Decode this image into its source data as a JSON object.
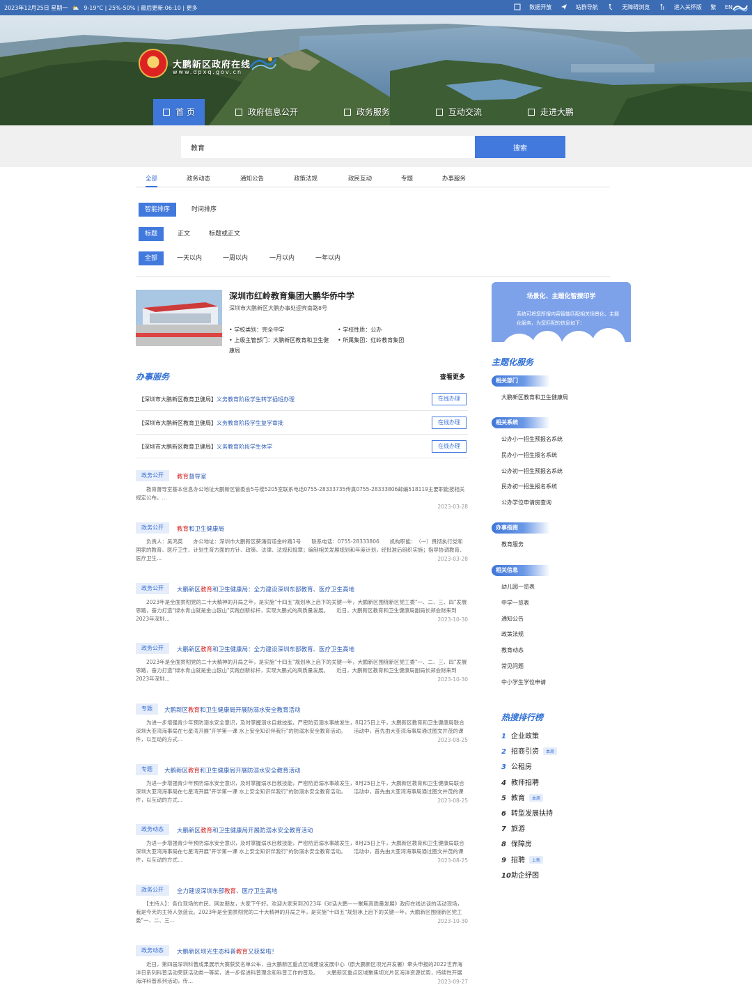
{
  "topbar": {
    "date": "2023年12月25日 星期一",
    "weather": "9-19°C | 25%-50% | 最后更新:06:10 | 更多",
    "links": [
      "数据开放",
      "站群导航",
      "无障碍浏览",
      "进入关怀版",
      "繁",
      "EN"
    ]
  },
  "banner": {
    "site_title": "大鹏新区政府在线",
    "site_url": "www.dpxq.gov.cn"
  },
  "nav": [
    "首  页",
    "政府信息公开",
    "政务服务",
    "互动交流",
    "走进大鹏"
  ],
  "search": {
    "value": "教育",
    "button": "搜索"
  },
  "category_tabs": [
    "全部",
    "政务动态",
    "通知公告",
    "政策法规",
    "政民互动",
    "专题",
    "办事服务"
  ],
  "sort_options": [
    "智能排序",
    "时间排序"
  ],
  "scope_options": [
    "标题",
    "正文",
    "标题或正文"
  ],
  "time_options": [
    "全部",
    "一天以内",
    "一周以内",
    "一月以内",
    "一年以内"
  ],
  "school": {
    "name": "深圳市红岭教育集团大鹏华侨中学",
    "address": "深圳市大鹏新区大鹏办事处迎宾南路8号",
    "type": "• 学校类别：完全中学",
    "nature": "• 学校性质：公办",
    "dept": "• 上级主管部门：大鹏新区教育和卫生健",
    "dept_cont": "康局",
    "group": "• 所属集团：红岭教育集团"
  },
  "affairs": {
    "title": "办事服务",
    "more": "查看更多",
    "items": [
      {
        "dept": "【深圳市大鹏新区教育卫健局】",
        "name": "义务教育阶段学生转学插班办理",
        "btn": "在线办理"
      },
      {
        "dept": "【深圳市大鹏新区教育卫健局】",
        "name": "义务教育阶段学生复学审批",
        "btn": "在线办理"
      },
      {
        "dept": "【深圳市大鹏新区教育卫健局】",
        "name": "义务教育阶段学生休学",
        "btn": "在线办理"
      }
    ]
  },
  "results": [
    {
      "tag": "政务公开",
      "pre": "",
      "hl": "教育",
      "post": "督导室",
      "snippet": "　　教育督导室基本信息办公地址大鹏新区管委会5号楼5205室联系电话0755-28333735传真0755-28333806邮编518119主要职能按相关规定公布。...",
      "date": "2023-03-28"
    },
    {
      "tag": "政务公开",
      "pre": "",
      "hl": "教育",
      "post": "和卫生健康局",
      "snippet": "　　负责人：吴鸿英　　办公地址：深圳市大鹏新区葵涌街道金岭路1号　　联系电话：0755-28333806　　机构职能：　（一）贯彻执行党和国家的教育、医疗卫生、计划生育方面的方针、政策、法律、法规和规章；编制相关发展规划和年度计划，经批准后组织实施；指导协调教育、医疗卫生...",
      "date": "2023-03-28"
    },
    {
      "tag": "政务公开",
      "pre": "大鹏新区",
      "hl": "教育",
      "post": "和卫生健康局：全力建设深圳东部教育、医疗卫生高地",
      "snippet": "　　2023年是全面贯彻党的二十大精神的开局之年，是实施\"十四五\"规划承上启下的关键一年，大鹏新区围绕新区党工委\"一、二、三、四\"发展思路，奋力打造\"绿水青山就是金山银山\"实践创新标杆，实现大鹏式的高质量发展。　　近日，大鹏新区教育和卫生健康局副局长郑会财来到2023年深圳...",
      "date": "2023-10-30"
    },
    {
      "tag": "政务公开",
      "pre": "大鹏新区",
      "hl": "教育",
      "post": "和卫生健康局：全力建设深圳东部教育、医疗卫生高地",
      "snippet": "　　2023年是全面贯彻党的二十大精神的开局之年，是实施\"十四五\"规划承上启下的关键一年，大鹏新区围绕新区党工委\"一、二、三、四\"发展思路，奋力打造\"绿水青山就是金山银山\"实践创新标杆，实现大鹏式的高质量发展。　　近日，大鹏新区教育和卫生健康局副局长郑会财来到2023年深圳...",
      "date": "2023-10-30"
    },
    {
      "tag": "专题",
      "pre": "大鹏新区",
      "hl": "教育",
      "post": "和卫生健康局开展防溺水安全教育活动",
      "snippet": "　　为进一步增强青少年预防溺水安全意识，及时掌握溺水自救技能，严密防范溺水事故发生，8月25日上午，大鹏新区教育和卫生健康局联合深圳大亚湾海事局在七星湾开展\"开学第一课 水上安全知识伴我行\"的防溺水安全教育活动。　　活动中，首先由大亚湾海事局通过图文并茂的课件，以互动的方式...",
      "date": "2023-08-25"
    },
    {
      "tag": "专题",
      "pre": "大鹏新区",
      "hl": "教育",
      "post": "和卫生健康局开展防溺水安全教育活动",
      "snippet": "　　为进一步增强青少年预防溺水安全意识，及时掌握溺水自救技能，严密防范溺水事故发生，8月25日上午，大鹏新区教育和卫生健康局联合深圳大亚湾海事局在七星湾开展\"开学第一课 水上安全知识伴我行\"的防溺水安全教育活动。　　活动中，首先由大亚湾海事局通过图文并茂的课件，以互动的方式...",
      "date": "2023-08-25"
    },
    {
      "tag": "政务动态",
      "pre": "大鹏新区",
      "hl": "教育",
      "post": "和卫生健康局开展防溺水安全教育活动",
      "snippet": "　　为进一步增强青少年预防溺水安全意识，及时掌握溺水自救技能，严密防范溺水事故发生，8月25日上午，大鹏新区教育和卫生健康局联合深圳大亚湾海事局在七星湾开展\"开学第一课 水上安全知识伴我行\"的防溺水安全教育活动。　　活动中，首先由大亚湾海事局通过图文并茂的课件，以互动的方式...",
      "date": "2023-08-25"
    },
    {
      "tag": "政务公开",
      "pre": "全力建设深圳东部",
      "hl": "教育",
      "post": "、医疗卫生高地",
      "snippet": "　　【主持人】：各位现场的市民、网友朋友，大家下午好。欢迎大家来到2023年《对话大鹏——聚焦高质量发展》政府在线访谈的活动现场，我是今天的主持人张蓝云。2023年是全面贯彻党的二十大精神的开局之年，是实施\"十四五\"规划承上启下的关键一年，大鹏新区围绕新区党工委\"一、二、三...",
      "date": "2023-10-30"
    },
    {
      "tag": "政务动态",
      "pre": "大鹏新区坝光生态科普",
      "hl": "教育",
      "post": "又获奖啦！",
      "snippet": "　　近日，第四届深圳科普成果展示大赛获奖名单公布，由大鹏新区重点区域建设发展中心（原大鹏新区坝光开发署）牵头申报的2022世界海洋日系列科普活动荣获活动类一等奖，进一步促进科普理念和科普工作的普及。　　大鹏新区重点区域聚焦坝光片区海洋资源优势，持续性开展海洋科普系列活动，传...",
      "date": "2023-09-27"
    }
  ],
  "sidebar": {
    "promo_title": "场景化、主题化智搜印学",
    "promo_text": "系统可将您所搜内容智能匹配相关场景化、主题化服务，为您匹配的信息如下：",
    "section_title": "主题化服务",
    "groups": [
      {
        "label": "相关部门",
        "links": [
          "大鹏新区教育和卫生健康局"
        ]
      },
      {
        "label": "相关系统",
        "links": [
          "公办小一招生预报名系统",
          "民办小一招生报名系统",
          "公办初一招生预报名系统",
          "民办初一招生报名系统",
          "公办学位申请房查询"
        ]
      },
      {
        "label": "办事指南",
        "links": [
          "教育服务"
        ]
      },
      {
        "label": "相关信息",
        "links": [
          "幼儿园一览表",
          "中学一览表",
          "通知公告",
          "政策法规",
          "教育动态",
          "常见问题",
          "中小学生学位申请"
        ]
      }
    ],
    "hot_title": "热搜排行榜",
    "hot": [
      {
        "n": "1",
        "t": "企业政策",
        "b": ""
      },
      {
        "n": "2",
        "t": "招商引资",
        "b": "本周"
      },
      {
        "n": "3",
        "t": "公租房",
        "b": ""
      },
      {
        "n": "4",
        "t": "教师招聘",
        "b": ""
      },
      {
        "n": "5",
        "t": "教育",
        "b": "本周"
      },
      {
        "n": "6",
        "t": "转型发展扶持",
        "b": ""
      },
      {
        "n": "7",
        "t": "旅游",
        "b": ""
      },
      {
        "n": "8",
        "t": "保障房",
        "b": ""
      },
      {
        "n": "9",
        "t": "招聘",
        "b": "上新"
      },
      {
        "n": "10",
        "t": "助企纾困",
        "b": ""
      }
    ]
  },
  "colors": {
    "primary": "#4279dd",
    "topbar": "#3c6cb4",
    "highlight": "#d42a2a"
  }
}
